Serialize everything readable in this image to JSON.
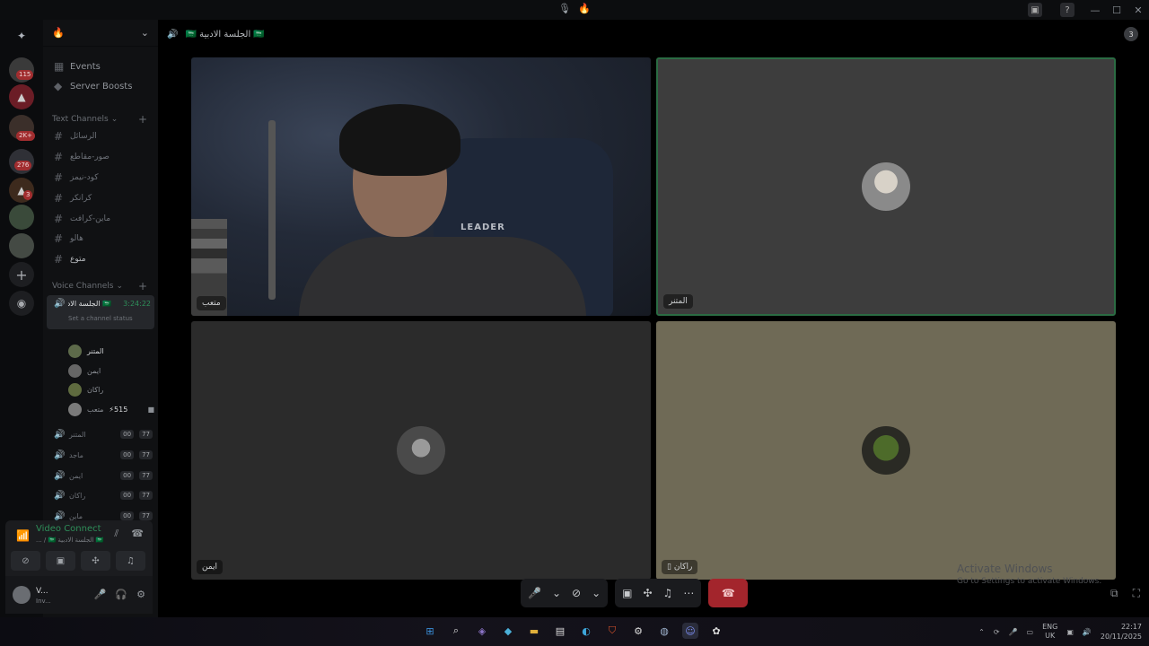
{
  "window": {
    "title_icons": [
      "voice-call-icon",
      "fire-icon"
    ],
    "win_controls": [
      "—",
      "☐",
      "✕"
    ]
  },
  "rail": {
    "servers": [
      {
        "name": "server-1",
        "badge": "115"
      },
      {
        "name": "server-2",
        "badge": ""
      },
      {
        "name": "server-3",
        "badge": "2K+"
      },
      {
        "name": "server-4",
        "badge": "276"
      },
      {
        "name": "server-5",
        "badge": "3"
      },
      {
        "name": "server-6",
        "badge": ""
      },
      {
        "name": "server-7",
        "badge": ""
      }
    ]
  },
  "server_header": {
    "icon": "🔥"
  },
  "sidebar": {
    "events": "Events",
    "boosts": "Server Boosts",
    "text_category": "Text Channels",
    "text_channels": [
      "الرسائل",
      "صور-مقاطع",
      "كود-نيمز",
      "كرانكر",
      "ماين-كرافت",
      "هالو",
      "متوع"
    ],
    "voice_category": "Voice Channels",
    "active_voice": {
      "name": "🇸🇦 الجلسة الادبية",
      "timer": "3:24:22",
      "status": "Set a channel status"
    },
    "members": [
      {
        "name": "المتنر",
        "extra": ""
      },
      {
        "name": "ايمن",
        "extra": ""
      },
      {
        "name": "راكان",
        "extra": ""
      },
      {
        "name": "متعب",
        "extra": "515"
      }
    ],
    "voice_channels": [
      {
        "name": "المتنر",
        "a": "00",
        "b": "77"
      },
      {
        "name": "ماجد",
        "a": "00",
        "b": "77"
      },
      {
        "name": "ايمن",
        "a": "00",
        "b": "77"
      },
      {
        "name": "راكان",
        "a": "00",
        "b": "77"
      },
      {
        "name": "ماين",
        "a": "00",
        "b": "77"
      }
    ]
  },
  "voice_panel": {
    "title": "Video Connect",
    "subtitle": "🇸🇦 الجلسة الادبية 🇸🇦 / ..."
  },
  "user": {
    "name": "V...",
    "status": "Inv..."
  },
  "main": {
    "channel_name": "🇸🇦 الجلسة الادبية 🇸🇦",
    "activity_count": "3",
    "tiles": [
      {
        "label": "متعب",
        "kind": "webcam"
      },
      {
        "label": "المتنر",
        "kind": "avatar"
      },
      {
        "label": "ايمن",
        "kind": "avatar"
      },
      {
        "label": "راكان",
        "kind": "avatar"
      }
    ],
    "leader_text": "LEADER"
  },
  "colors": {
    "accent": "#2e8e59",
    "hangup": "#a3252c",
    "tile_gray": "#3d3d3d",
    "tile_dark": "#2b2b2b",
    "tile_khaki": "#6f6a56"
  },
  "watermark": {
    "line1": "Activate Windows",
    "line2": "Go to Settings to activate Windows."
  },
  "taskbar": {
    "lang_top": "ENG",
    "lang_bottom": "UK",
    "time": "22:17",
    "date": "20/11/2025"
  }
}
